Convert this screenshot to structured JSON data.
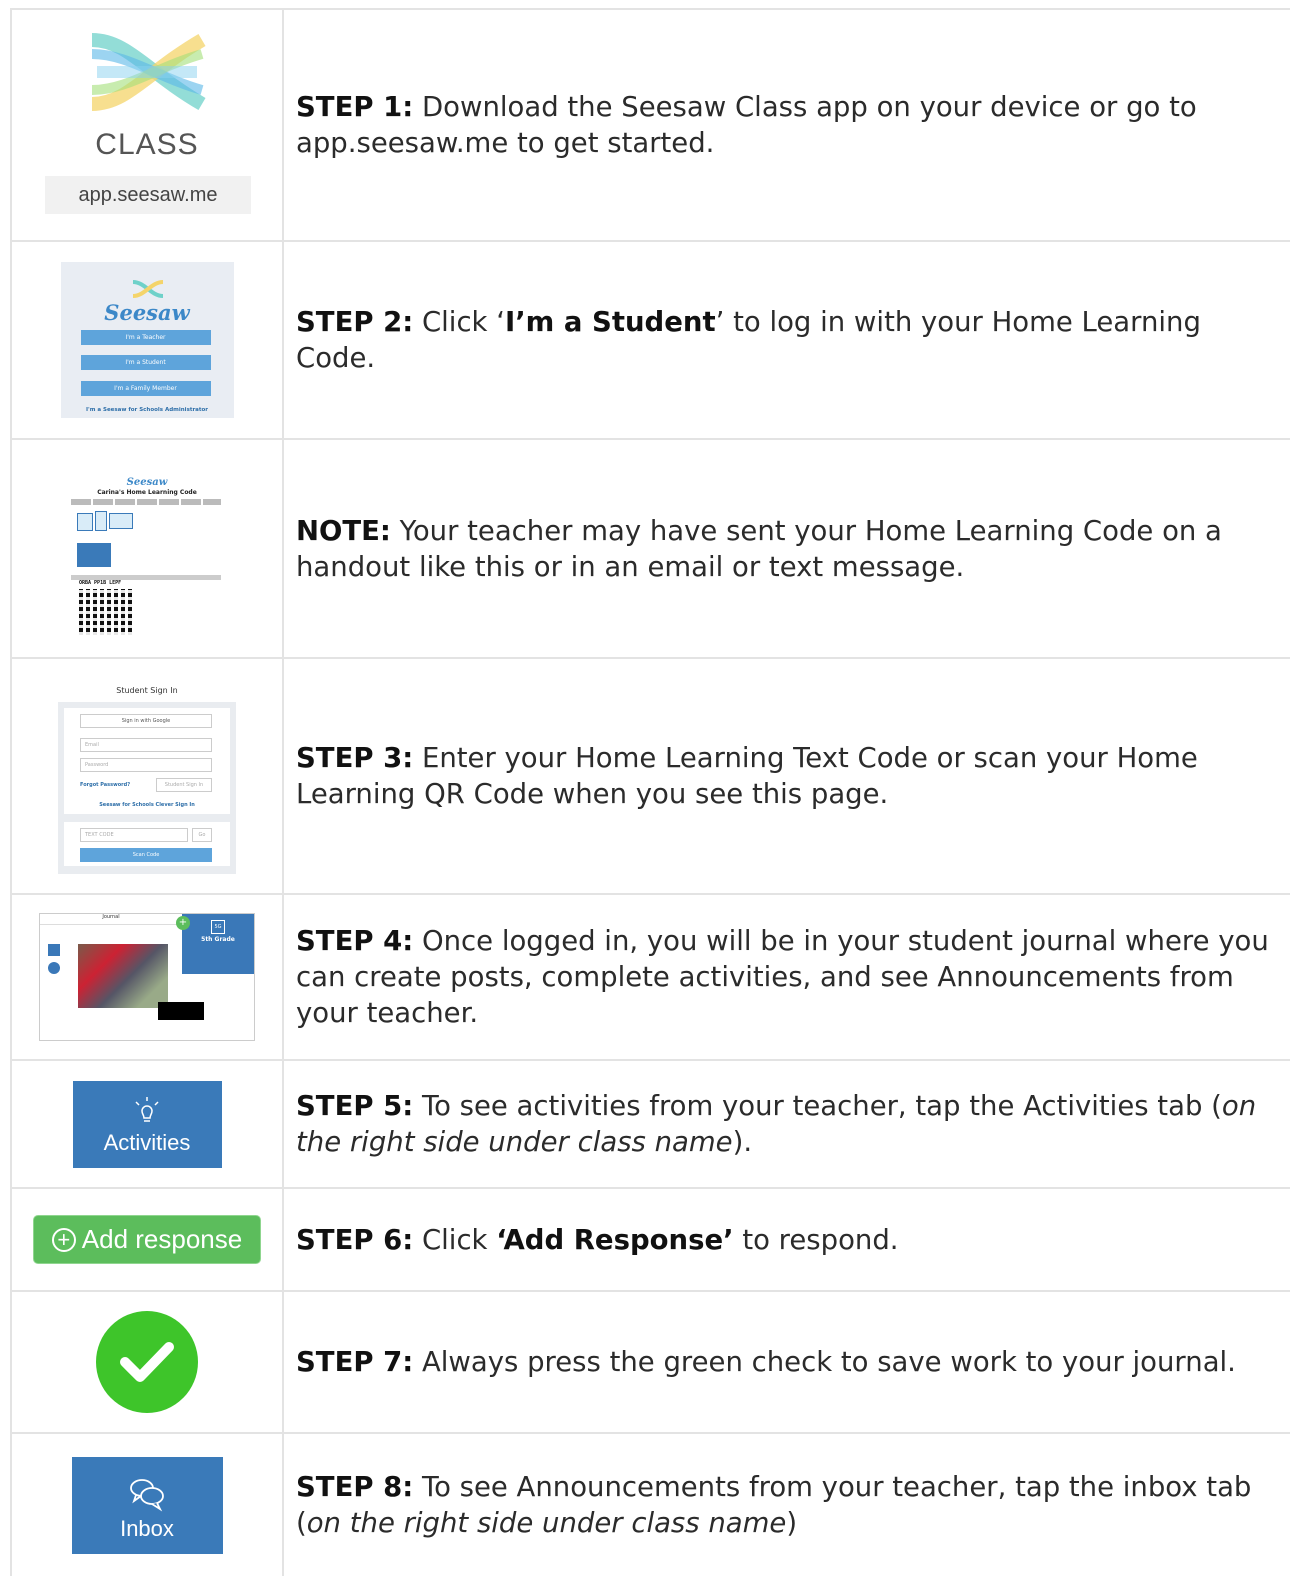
{
  "steps": [
    {
      "label": "STEP 1:",
      "text": " Download the Seesaw Class app on your device or go to app.seesaw.me to get started.",
      "image": {
        "class_word": "CLASS",
        "url": "app.seesaw.me"
      }
    },
    {
      "label": "STEP 2:",
      "pre": " Click ‘",
      "bold": "I’m a Student",
      "post": "’ to log in with your Home Learning Code.",
      "image": {
        "logo": "Seesaw",
        "buttons": [
          "I'm a Teacher",
          "I'm a Student",
          "I'm a Family Member"
        ],
        "admin": "I'm a Seesaw for Schools Administrator"
      }
    },
    {
      "label": "NOTE:",
      "text": " Your teacher may have sent your Home Learning Code on a handout like this or in an email or text message.",
      "image": {
        "logo": "Seesaw",
        "heading": "Carina's Home Learning Code",
        "code": "ORBA PP1B LEPF"
      }
    },
    {
      "label": "STEP 3:",
      "text": " Enter your Home Learning Text Code or scan your Home Learning QR Code when you see this page.",
      "image": {
        "title": "Student Sign In",
        "google": "Sign in with Google",
        "email": "Email",
        "password": "Password",
        "forgot": "Forgot Password?",
        "signin": "Student Sign In",
        "clever": "Seesaw for Schools Clever Sign In",
        "text_code": "TEXT CODE",
        "go": "Go",
        "scan": "Scan Code"
      }
    },
    {
      "label": "STEP 4:",
      "text": " Once logged in, you will be in your student journal where you can create posts, complete activities, and see Announcements from your teacher.",
      "image": {
        "journal": "Journal",
        "class": "5th Grade",
        "badge": "5G"
      }
    },
    {
      "label": "STEP 5:",
      "pre": " To see activities from your teacher, tap the Activities tab (",
      "italic": "on the right side under class name",
      "post": ").",
      "image": {
        "label": "Activities",
        "icon": "lightbulb-icon"
      }
    },
    {
      "label": "STEP 6:",
      "pre": " Click ",
      "bold": "‘Add Response’",
      "post": " to respond.",
      "image": {
        "label": "Add response",
        "icon": "plus-circle-icon"
      }
    },
    {
      "label": "STEP 7:",
      "text": " Always press the green check to save work to your journal.",
      "image": {
        "icon": "check-icon",
        "color": "#3ec52a"
      }
    },
    {
      "label": "STEP 8:",
      "pre": " To see Announcements from your teacher, tap the inbox tab (",
      "italic": "on the right side under class name",
      "post": ")",
      "image": {
        "label": "Inbox",
        "icon": "chat-bubbles-icon"
      }
    }
  ]
}
